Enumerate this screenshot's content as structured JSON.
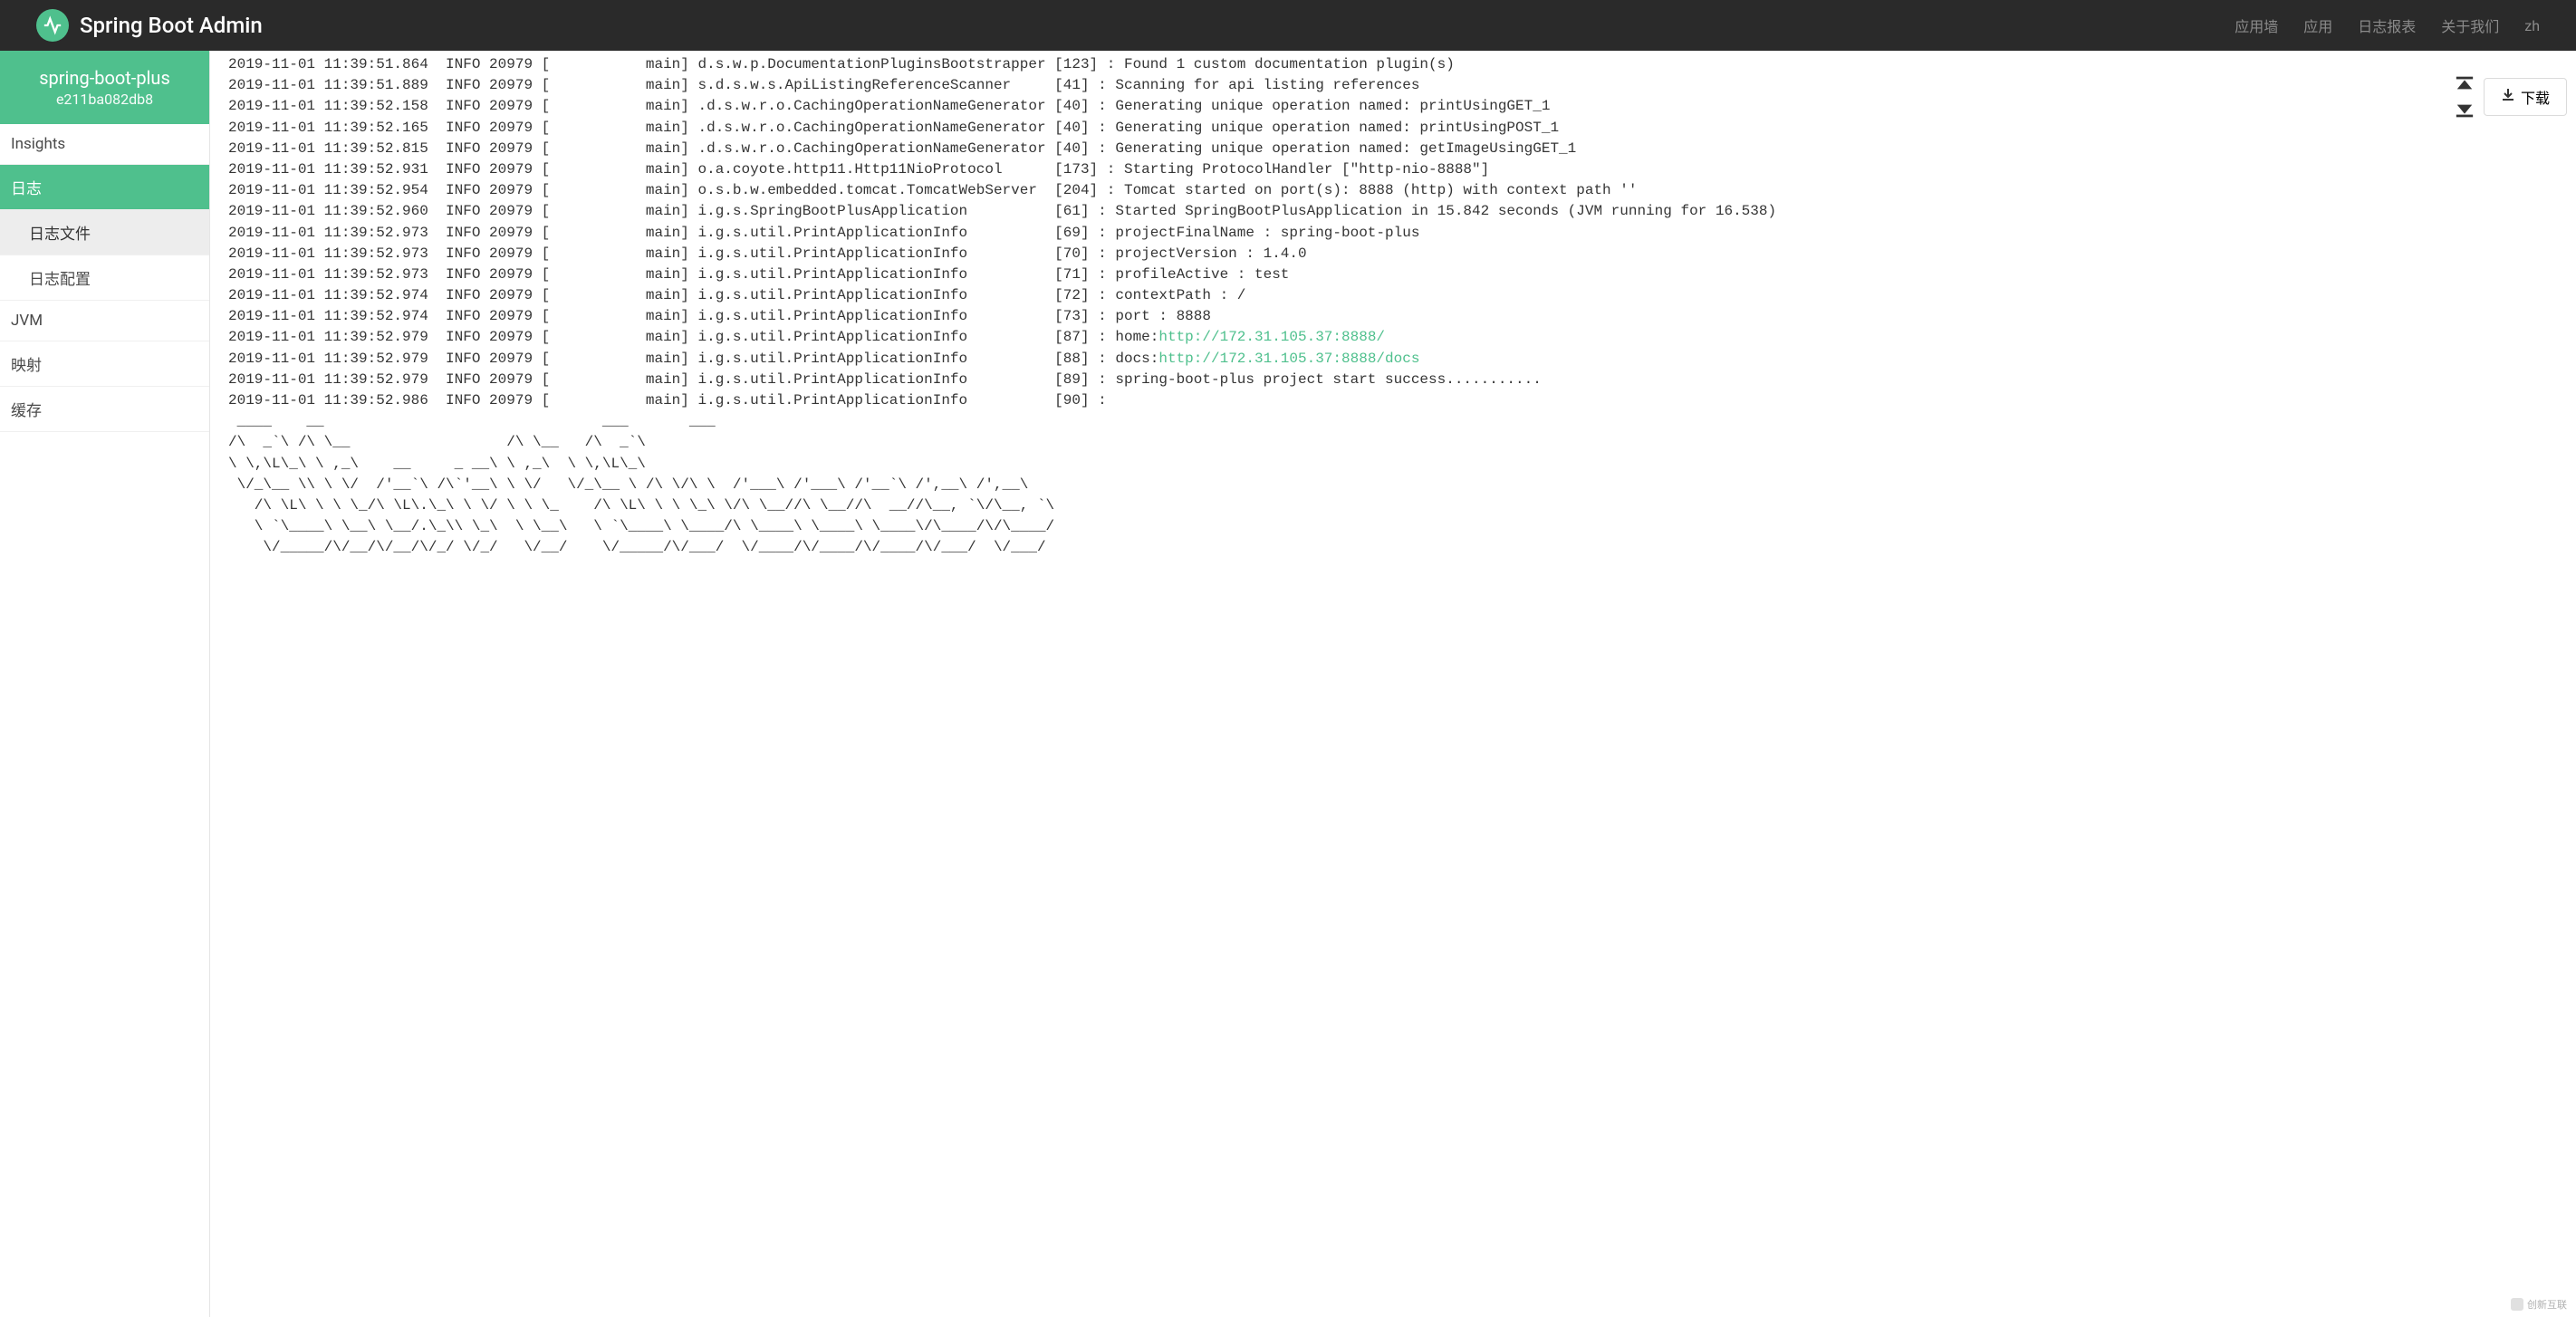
{
  "header": {
    "title": "Spring Boot Admin",
    "nav": [
      {
        "label": "应用墙"
      },
      {
        "label": "应用"
      },
      {
        "label": "日志报表"
      },
      {
        "label": "关于我们"
      },
      {
        "label": "zh"
      }
    ]
  },
  "instance": {
    "name": "spring-boot-plus",
    "id": "e211ba082db8"
  },
  "sidebar": {
    "items": [
      {
        "label": "Insights",
        "level": 1
      },
      {
        "label": "日志",
        "level": 1,
        "activeParent": true
      },
      {
        "label": "日志文件",
        "level": 2,
        "active": true
      },
      {
        "label": "日志配置",
        "level": 2
      },
      {
        "label": "JVM",
        "level": 1
      },
      {
        "label": "映射",
        "level": 1
      },
      {
        "label": "缓存",
        "level": 1
      }
    ]
  },
  "controls": {
    "download_label": "下载"
  },
  "log": {
    "lines": [
      {
        "text": "2019-11-01 11:39:51.864  INFO 20979 [           main] d.s.w.p.DocumentationPluginsBootstrapper [123] : Found 1 custom documentation plugin(s)"
      },
      {
        "text": "2019-11-01 11:39:51.889  INFO 20979 [           main] s.d.s.w.s.ApiListingReferenceScanner     [41] : Scanning for api listing references"
      },
      {
        "text": "2019-11-01 11:39:52.158  INFO 20979 [           main] .d.s.w.r.o.CachingOperationNameGenerator [40] : Generating unique operation named: printUsingGET_1"
      },
      {
        "text": "2019-11-01 11:39:52.165  INFO 20979 [           main] .d.s.w.r.o.CachingOperationNameGenerator [40] : Generating unique operation named: printUsingPOST_1"
      },
      {
        "text": "2019-11-01 11:39:52.815  INFO 20979 [           main] .d.s.w.r.o.CachingOperationNameGenerator [40] : Generating unique operation named: getImageUsingGET_1"
      },
      {
        "text": "2019-11-01 11:39:52.931  INFO 20979 [           main] o.a.coyote.http11.Http11NioProtocol      [173] : Starting ProtocolHandler [\"http-nio-8888\"]"
      },
      {
        "text": "2019-11-01 11:39:52.954  INFO 20979 [           main] o.s.b.w.embedded.tomcat.TomcatWebServer  [204] : Tomcat started on port(s): 8888 (http) with context path ''"
      },
      {
        "text": "2019-11-01 11:39:52.960  INFO 20979 [           main] i.g.s.SpringBootPlusApplication          [61] : Started SpringBootPlusApplication in 15.842 seconds (JVM running for 16.538)"
      },
      {
        "text": "2019-11-01 11:39:52.973  INFO 20979 [           main] i.g.s.util.PrintApplicationInfo          [69] : projectFinalName : spring-boot-plus"
      },
      {
        "text": "2019-11-01 11:39:52.973  INFO 20979 [           main] i.g.s.util.PrintApplicationInfo          [70] : projectVersion : 1.4.0"
      },
      {
        "text": "2019-11-01 11:39:52.973  INFO 20979 [           main] i.g.s.util.PrintApplicationInfo          [71] : profileActive : test"
      },
      {
        "text": "2019-11-01 11:39:52.974  INFO 20979 [           main] i.g.s.util.PrintApplicationInfo          [72] : contextPath : /"
      },
      {
        "text": "2019-11-01 11:39:52.974  INFO 20979 [           main] i.g.s.util.PrintApplicationInfo          [73] : port : 8888"
      },
      {
        "prefix": "2019-11-01 11:39:52.979  INFO 20979 [           main] i.g.s.util.PrintApplicationInfo          [87] : home:",
        "link": "http://172.31.105.37:8888/"
      },
      {
        "prefix": "2019-11-01 11:39:52.979  INFO 20979 [           main] i.g.s.util.PrintApplicationInfo          [88] : docs:",
        "link": "http://172.31.105.37:8888/docs"
      },
      {
        "text": "2019-11-01 11:39:52.979  INFO 20979 [           main] i.g.s.util.PrintApplicationInfo          [89] : spring-boot-plus project start success..........."
      },
      {
        "text": "2019-11-01 11:39:52.986  INFO 20979 [           main] i.g.s.util.PrintApplicationInfo          [90] : "
      },
      {
        "text": " ____    __                                ___       ___"
      },
      {
        "text": "/\\  _`\\ /\\ \\__                  /\\ \\__   /\\  _`\\"
      },
      {
        "text": "\\ \\,\\L\\_\\ \\ ,_\\    __     _ __\\ \\ ,_\\  \\ \\,\\L\\_\\"
      },
      {
        "text": " \\/_\\__ \\\\ \\ \\/  /'__`\\ /\\`'__\\ \\ \\/   \\/_\\__ \\ /\\ \\/\\ \\  /'___\\ /'___\\ /'__`\\ /',__\\ /',__\\"
      },
      {
        "text": "   /\\ \\L\\ \\ \\ \\_/\\ \\L\\.\\_\\ \\ \\/ \\ \\ \\_    /\\ \\L\\ \\ \\ \\_\\ \\/\\ \\__//\\ \\__//\\  __//\\__, `\\/\\__, `\\"
      },
      {
        "text": "   \\ `\\____\\ \\__\\ \\__/.\\_\\\\ \\_\\  \\ \\__\\   \\ `\\____\\ \\____/\\ \\____\\ \\____\\ \\____\\/\\____/\\/\\____/"
      },
      {
        "text": "    \\/_____/\\/__/\\/__/\\/_/ \\/_/   \\/__/    \\/_____/\\/___/  \\/____/\\/____/\\/____/\\/___/  \\/___/"
      }
    ]
  },
  "watermark": {
    "text": "创新互联"
  }
}
